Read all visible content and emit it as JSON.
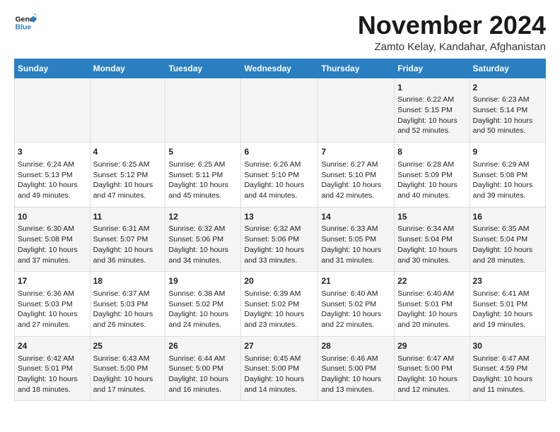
{
  "header": {
    "logo_line1": "General",
    "logo_line2": "Blue",
    "month": "November 2024",
    "location": "Zamto Kelay, Kandahar, Afghanistan"
  },
  "weekdays": [
    "Sunday",
    "Monday",
    "Tuesday",
    "Wednesday",
    "Thursday",
    "Friday",
    "Saturday"
  ],
  "weeks": [
    [
      {
        "day": "",
        "text": ""
      },
      {
        "day": "",
        "text": ""
      },
      {
        "day": "",
        "text": ""
      },
      {
        "day": "",
        "text": ""
      },
      {
        "day": "",
        "text": ""
      },
      {
        "day": "1",
        "text": "Sunrise: 6:22 AM\nSunset: 5:15 PM\nDaylight: 10 hours and 52 minutes."
      },
      {
        "day": "2",
        "text": "Sunrise: 6:23 AM\nSunset: 5:14 PM\nDaylight: 10 hours and 50 minutes."
      }
    ],
    [
      {
        "day": "3",
        "text": "Sunrise: 6:24 AM\nSunset: 5:13 PM\nDaylight: 10 hours and 49 minutes."
      },
      {
        "day": "4",
        "text": "Sunrise: 6:25 AM\nSunset: 5:12 PM\nDaylight: 10 hours and 47 minutes."
      },
      {
        "day": "5",
        "text": "Sunrise: 6:25 AM\nSunset: 5:11 PM\nDaylight: 10 hours and 45 minutes."
      },
      {
        "day": "6",
        "text": "Sunrise: 6:26 AM\nSunset: 5:10 PM\nDaylight: 10 hours and 44 minutes."
      },
      {
        "day": "7",
        "text": "Sunrise: 6:27 AM\nSunset: 5:10 PM\nDaylight: 10 hours and 42 minutes."
      },
      {
        "day": "8",
        "text": "Sunrise: 6:28 AM\nSunset: 5:09 PM\nDaylight: 10 hours and 40 minutes."
      },
      {
        "day": "9",
        "text": "Sunrise: 6:29 AM\nSunset: 5:08 PM\nDaylight: 10 hours and 39 minutes."
      }
    ],
    [
      {
        "day": "10",
        "text": "Sunrise: 6:30 AM\nSunset: 5:08 PM\nDaylight: 10 hours and 37 minutes."
      },
      {
        "day": "11",
        "text": "Sunrise: 6:31 AM\nSunset: 5:07 PM\nDaylight: 10 hours and 36 minutes."
      },
      {
        "day": "12",
        "text": "Sunrise: 6:32 AM\nSunset: 5:06 PM\nDaylight: 10 hours and 34 minutes."
      },
      {
        "day": "13",
        "text": "Sunrise: 6:32 AM\nSunset: 5:06 PM\nDaylight: 10 hours and 33 minutes."
      },
      {
        "day": "14",
        "text": "Sunrise: 6:33 AM\nSunset: 5:05 PM\nDaylight: 10 hours and 31 minutes."
      },
      {
        "day": "15",
        "text": "Sunrise: 6:34 AM\nSunset: 5:04 PM\nDaylight: 10 hours and 30 minutes."
      },
      {
        "day": "16",
        "text": "Sunrise: 6:35 AM\nSunset: 5:04 PM\nDaylight: 10 hours and 28 minutes."
      }
    ],
    [
      {
        "day": "17",
        "text": "Sunrise: 6:36 AM\nSunset: 5:03 PM\nDaylight: 10 hours and 27 minutes."
      },
      {
        "day": "18",
        "text": "Sunrise: 6:37 AM\nSunset: 5:03 PM\nDaylight: 10 hours and 26 minutes."
      },
      {
        "day": "19",
        "text": "Sunrise: 6:38 AM\nSunset: 5:02 PM\nDaylight: 10 hours and 24 minutes."
      },
      {
        "day": "20",
        "text": "Sunrise: 6:39 AM\nSunset: 5:02 PM\nDaylight: 10 hours and 23 minutes."
      },
      {
        "day": "21",
        "text": "Sunrise: 6:40 AM\nSunset: 5:02 PM\nDaylight: 10 hours and 22 minutes."
      },
      {
        "day": "22",
        "text": "Sunrise: 6:40 AM\nSunset: 5:01 PM\nDaylight: 10 hours and 20 minutes."
      },
      {
        "day": "23",
        "text": "Sunrise: 6:41 AM\nSunset: 5:01 PM\nDaylight: 10 hours and 19 minutes."
      }
    ],
    [
      {
        "day": "24",
        "text": "Sunrise: 6:42 AM\nSunset: 5:01 PM\nDaylight: 10 hours and 18 minutes."
      },
      {
        "day": "25",
        "text": "Sunrise: 6:43 AM\nSunset: 5:00 PM\nDaylight: 10 hours and 17 minutes."
      },
      {
        "day": "26",
        "text": "Sunrise: 6:44 AM\nSunset: 5:00 PM\nDaylight: 10 hours and 16 minutes."
      },
      {
        "day": "27",
        "text": "Sunrise: 6:45 AM\nSunset: 5:00 PM\nDaylight: 10 hours and 14 minutes."
      },
      {
        "day": "28",
        "text": "Sunrise: 6:46 AM\nSunset: 5:00 PM\nDaylight: 10 hours and 13 minutes."
      },
      {
        "day": "29",
        "text": "Sunrise: 6:47 AM\nSunset: 5:00 PM\nDaylight: 10 hours and 12 minutes."
      },
      {
        "day": "30",
        "text": "Sunrise: 6:47 AM\nSunset: 4:59 PM\nDaylight: 10 hours and 11 minutes."
      }
    ]
  ]
}
